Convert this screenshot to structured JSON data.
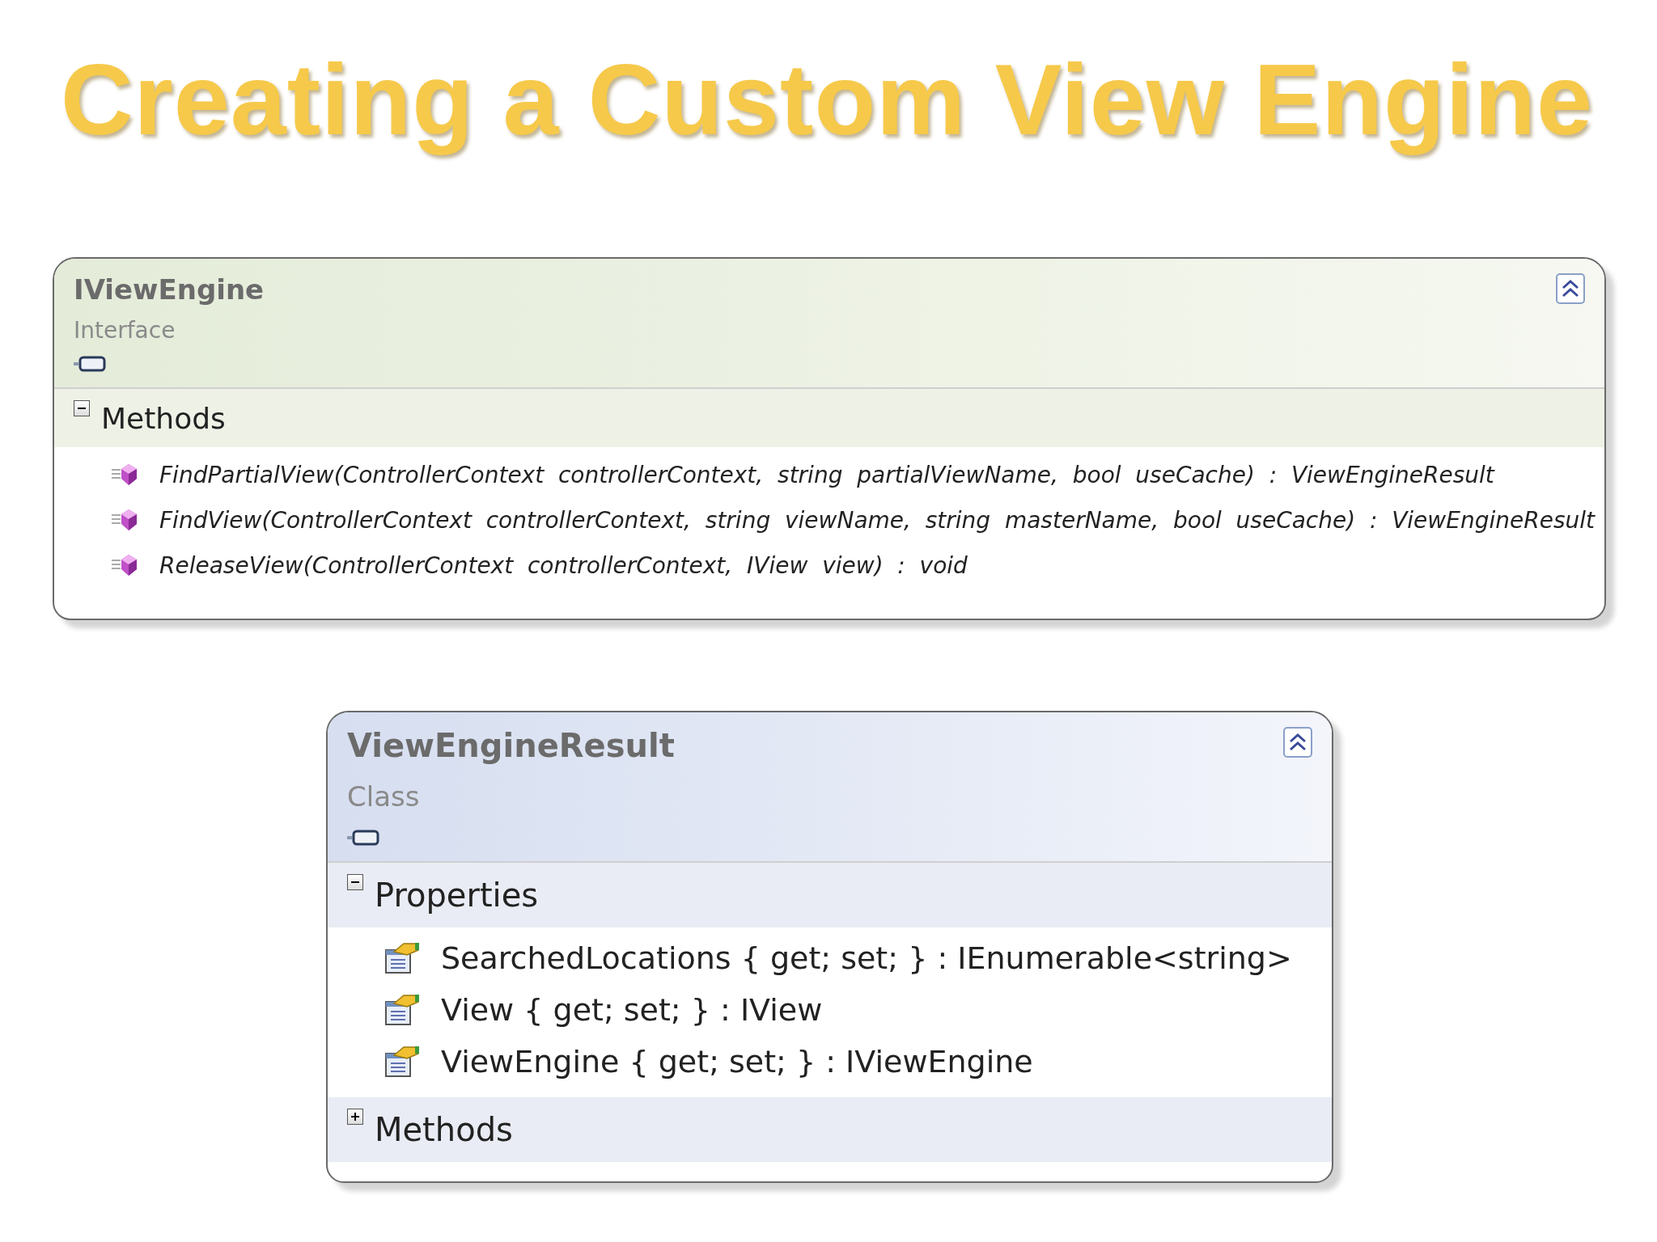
{
  "title": "Creating a Custom View Engine",
  "shapes": [
    {
      "name": "IViewEngine",
      "kind": "interface",
      "type_label": "Interface",
      "collapsed": false,
      "compartments": [
        {
          "label": "Methods",
          "expanded": true,
          "members": [
            {
              "kind": "method",
              "text": "FindPartialView(ControllerContext  controllerContext,  string  partialViewName,  bool  useCache)  :  ViewEngineResult"
            },
            {
              "kind": "method",
              "text": "FindView(ControllerContext  controllerContext,  string  viewName,  string  masterName,  bool  useCache)  :  ViewEngineResult"
            },
            {
              "kind": "method",
              "text": "ReleaseView(ControllerContext  controllerContext,  IView  view)  :  void"
            }
          ]
        }
      ]
    },
    {
      "name": "ViewEngineResult",
      "kind": "class",
      "type_label": "Class",
      "collapsed": false,
      "compartments": [
        {
          "label": "Properties",
          "expanded": true,
          "members": [
            {
              "kind": "property",
              "text": "SearchedLocations { get; set; } : IEnumerable<string>"
            },
            {
              "kind": "property",
              "text": "View { get; set; } : IView"
            },
            {
              "kind": "property",
              "text": "ViewEngine { get; set; } : IViewEngine"
            }
          ]
        },
        {
          "label": "Methods",
          "expanded": false
        }
      ]
    }
  ]
}
